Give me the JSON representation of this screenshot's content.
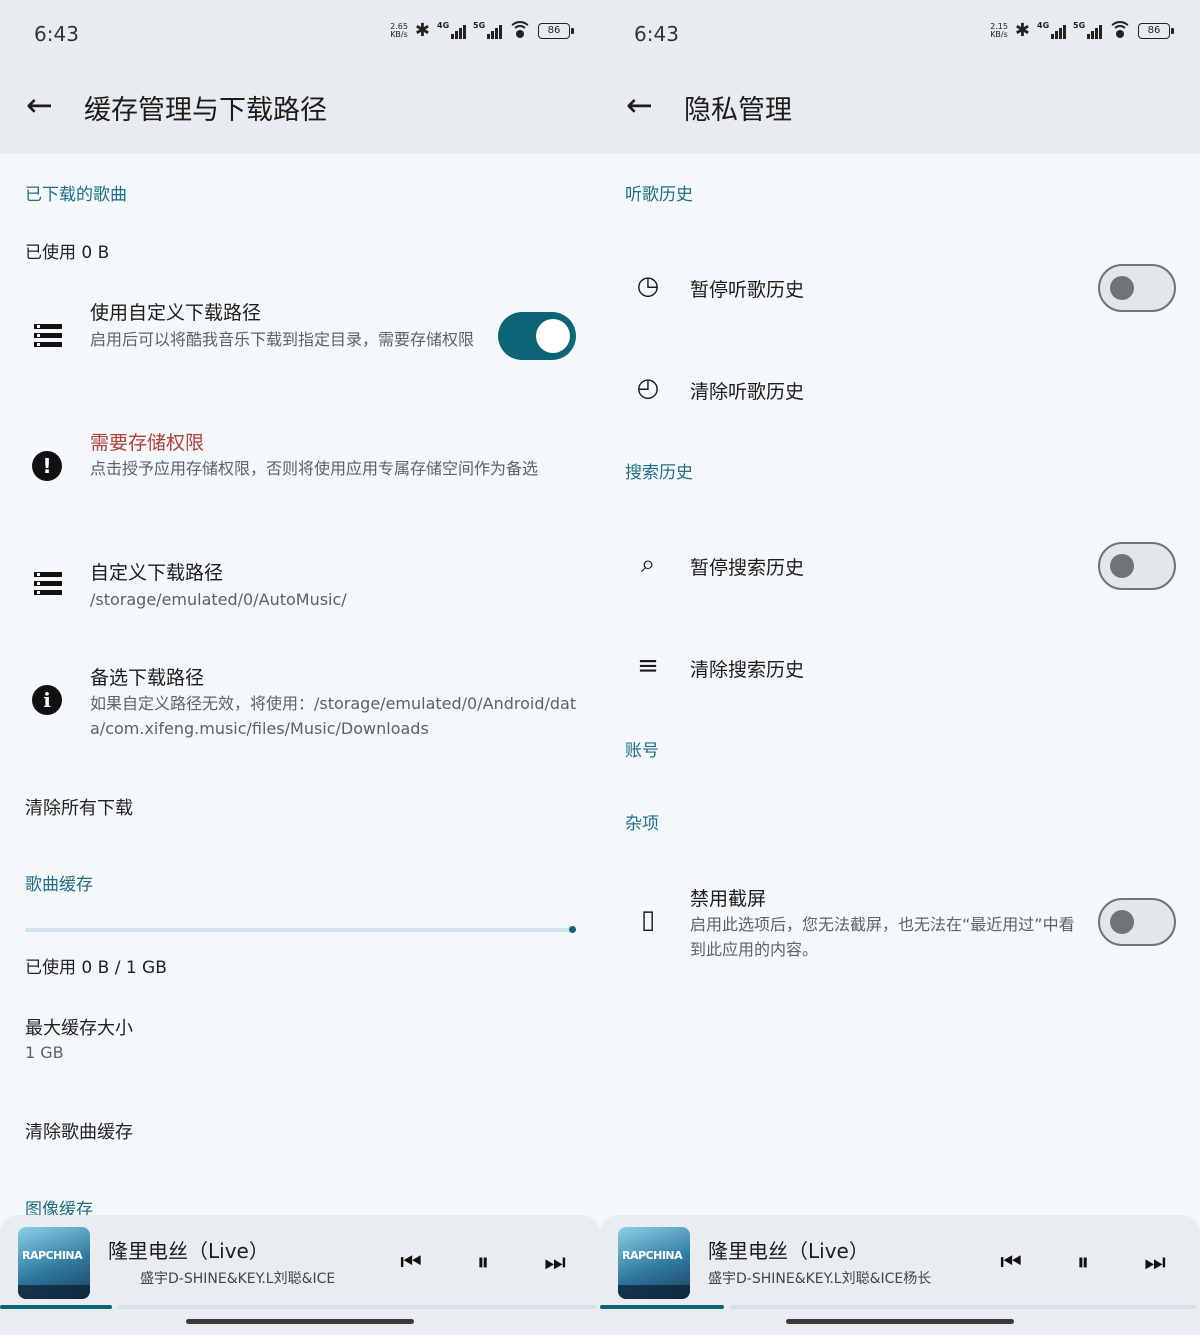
{
  "status_bar": {
    "left_time": "6:43",
    "left_speed_value": "2.65",
    "right_time": "6:43",
    "right_speed_value": "2.15",
    "speed_unit": "KB/s",
    "net1": "4G",
    "net2": "5G",
    "battery": "86"
  },
  "cache_page": {
    "title": "缓存管理与下载路径",
    "downloaded_section": "已下载的歌曲",
    "downloaded_used": "已使用 0 B",
    "custom_path_toggle": {
      "title": "使用自定义下载路径",
      "subtitle": "启用后可以将酷我音乐下载到指定目录，需要存储权限",
      "enabled": true
    },
    "storage_permission": {
      "title": "需要存储权限",
      "subtitle": "点击授予应用存储权限，否则将使用应用专属存储空间作为备选"
    },
    "custom_path": {
      "title": "自定义下载路径",
      "value": "/storage/emulated/0/AutoMusic/"
    },
    "fallback_path": {
      "title": "备选下载路径",
      "value": "如果自定义路径无效，将使用：/storage/emulated/0/Android/data/com.xifeng.music/files/Music/Downloads"
    },
    "clear_downloads": "清除所有下载",
    "song_cache_section": "歌曲缓存",
    "song_cache_used_fraction": 0,
    "song_cache_used": "已使用 0 B / 1 GB",
    "max_cache_title": "最大缓存大小",
    "max_cache_value": "1 GB",
    "clear_song_cache": "清除歌曲缓存",
    "image_cache_section": "图像缓存"
  },
  "privacy_page": {
    "title": "隐私管理",
    "listen_history_section": "听歌历史",
    "pause_listen_history": {
      "label": "暂停听歌历史",
      "enabled": false
    },
    "clear_listen_history": "清除听歌历史",
    "search_history_section": "搜索历史",
    "pause_search_history": {
      "label": "暂停搜索历史",
      "enabled": false
    },
    "clear_search_history": "清除搜索历史",
    "account_section": "账号",
    "misc_section": "杂项",
    "disable_screenshot": {
      "title": "禁用截屏",
      "subtitle": "启用此选项后，您无法截屏，也无法在“最近用过”中看到此应用的内容。",
      "enabled": false
    }
  },
  "player_left": {
    "song": "隆里电丝（Live）",
    "artist": "盛宇D-SHINE&KEY.L刘聪&ICE",
    "cover_text": "RAPCHINA",
    "progress_fraction": 0.19
  },
  "player_right": {
    "song": "隆里电丝（Live）",
    "artist": "盛宇D-SHINE&KEY.L刘聪&ICE杨长",
    "cover_text": "RAPCHINA",
    "progress_fraction": 0.21
  },
  "icons": {
    "back": "arrow-left-icon",
    "storage": "storage-icon",
    "alert": "alert-icon",
    "info": "info-icon",
    "history": "history-icon",
    "history_clear": "history-clear-icon",
    "search_off": "search-off-icon",
    "clear_all": "clear-all-icon",
    "screenshot": "phone-screenshot-icon",
    "prev": "skip-previous-icon",
    "pause": "pause-icon",
    "next": "skip-next-icon"
  },
  "colors": {
    "accent": "#0c6577",
    "section_header": "#1f6e85",
    "warning": "#b03e3a",
    "background": "#f5f8fa",
    "top_bar": "#e9ecee"
  }
}
